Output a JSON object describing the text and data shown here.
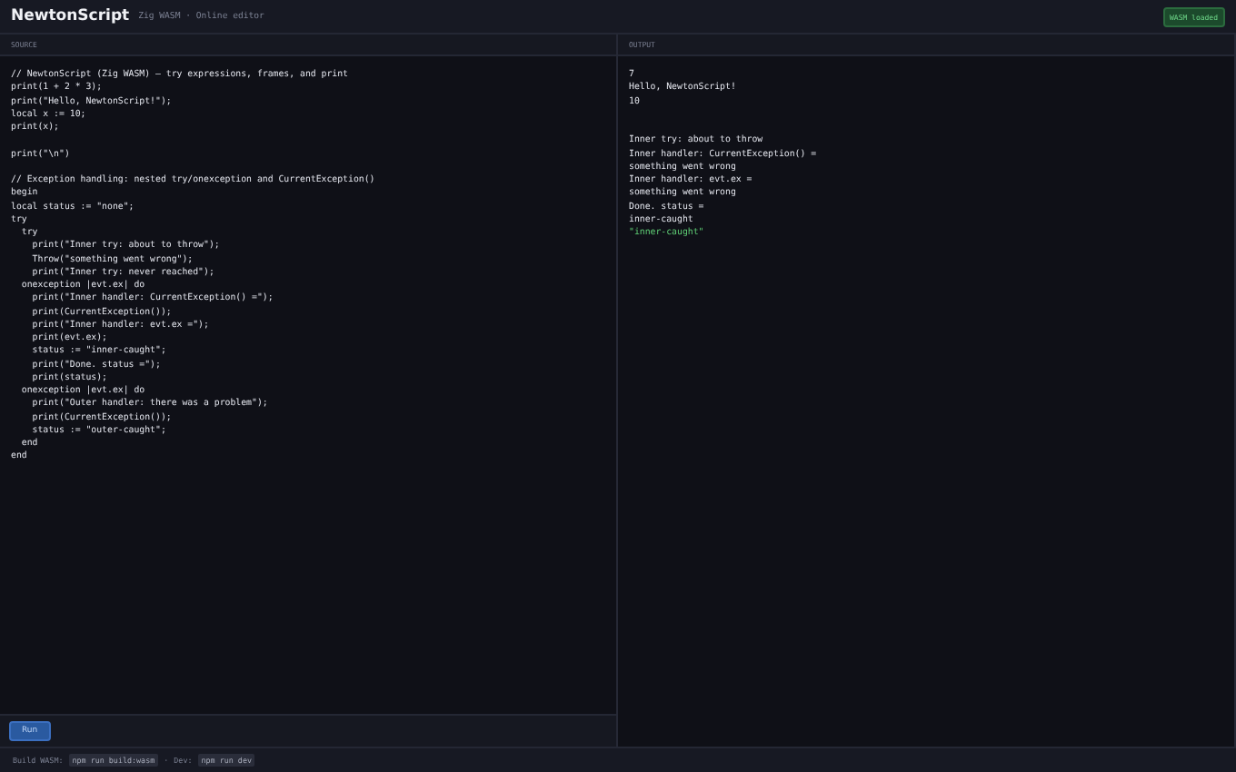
{
  "header": {
    "title": "NewtonScript",
    "subtitle": "Zig WASM · Online editor",
    "badge": "WASM loaded"
  },
  "source": {
    "label": "SOURCE",
    "lines": [
      {
        "kind": "code",
        "text": "// NewtonScript (Zig WASM) — try expressions, frames, and print"
      },
      {
        "kind": "code",
        "text": "print(1 + 2 * 3);"
      },
      {
        "kind": "code",
        "text": "print(\"Hello, NewtonScript!\");"
      },
      {
        "kind": "code",
        "text": "local x := 10;"
      },
      {
        "kind": "code",
        "text": "print(x);"
      },
      {
        "kind": "blank"
      },
      {
        "kind": "code",
        "text": "print(\"\\n\")"
      },
      {
        "kind": "blank"
      },
      {
        "kind": "code",
        "text": "// Exception handling: nested try/onexception and CurrentException()"
      },
      {
        "kind": "code",
        "text": "begin"
      },
      {
        "kind": "code",
        "text": "local status := \"none\";"
      },
      {
        "kind": "code",
        "text": "try"
      },
      {
        "kind": "code",
        "text": "  try"
      },
      {
        "kind": "code",
        "text": "    print(\"Inner try: about to throw\");"
      },
      {
        "kind": "code",
        "text": "    Throw(\"something went wrong\");"
      },
      {
        "kind": "code",
        "text": "    print(\"Inner try: never reached\");"
      },
      {
        "kind": "code",
        "text": "  onexception |evt.ex| do"
      },
      {
        "kind": "code",
        "text": "    print(\"Inner handler: CurrentException() =\");"
      },
      {
        "kind": "code",
        "text": "    print(CurrentException());"
      },
      {
        "kind": "code",
        "text": "    print(\"Inner handler: evt.ex =\");"
      },
      {
        "kind": "code",
        "text": "    print(evt.ex);"
      },
      {
        "kind": "code",
        "text": "    status := \"inner-caught\";"
      },
      {
        "kind": "code",
        "text": "    print(\"Done. status =\");"
      },
      {
        "kind": "code",
        "text": "    print(status);"
      },
      {
        "kind": "code",
        "text": "  onexception |evt.ex| do"
      },
      {
        "kind": "code",
        "text": "    print(\"Outer handler: there was a problem\");"
      },
      {
        "kind": "code",
        "text": "    print(CurrentException());"
      },
      {
        "kind": "code",
        "text": "    status := \"outer-caught\";"
      },
      {
        "kind": "code",
        "text": "  end"
      },
      {
        "kind": "code",
        "text": "end"
      }
    ],
    "run_button": "Run"
  },
  "output": {
    "label": "OUTPUT",
    "lines": [
      {
        "text": "7",
        "kind": "plain"
      },
      {
        "text": "Hello, NewtonScript!",
        "kind": "plain"
      },
      {
        "text": "10",
        "kind": "plain"
      },
      {
        "kind": "blank"
      },
      {
        "kind": "blank"
      },
      {
        "text": "Inner try: about to throw",
        "kind": "plain"
      },
      {
        "text": "Inner handler: CurrentException() =",
        "kind": "plain"
      },
      {
        "text": "something went wrong",
        "kind": "plain"
      },
      {
        "text": "Inner handler: evt.ex =",
        "kind": "plain"
      },
      {
        "text": "something went wrong",
        "kind": "plain"
      },
      {
        "text": "Done. status =",
        "kind": "plain"
      },
      {
        "text": "inner-caught",
        "kind": "plain"
      },
      {
        "text": "\"inner-caught\"",
        "kind": "string"
      }
    ]
  },
  "footer": {
    "items": [
      {
        "label": "Build WASM:",
        "command": "npm run build:wasm"
      },
      {
        "label": "Dev:",
        "command": "npm run dev"
      }
    ],
    "separator": "·"
  }
}
